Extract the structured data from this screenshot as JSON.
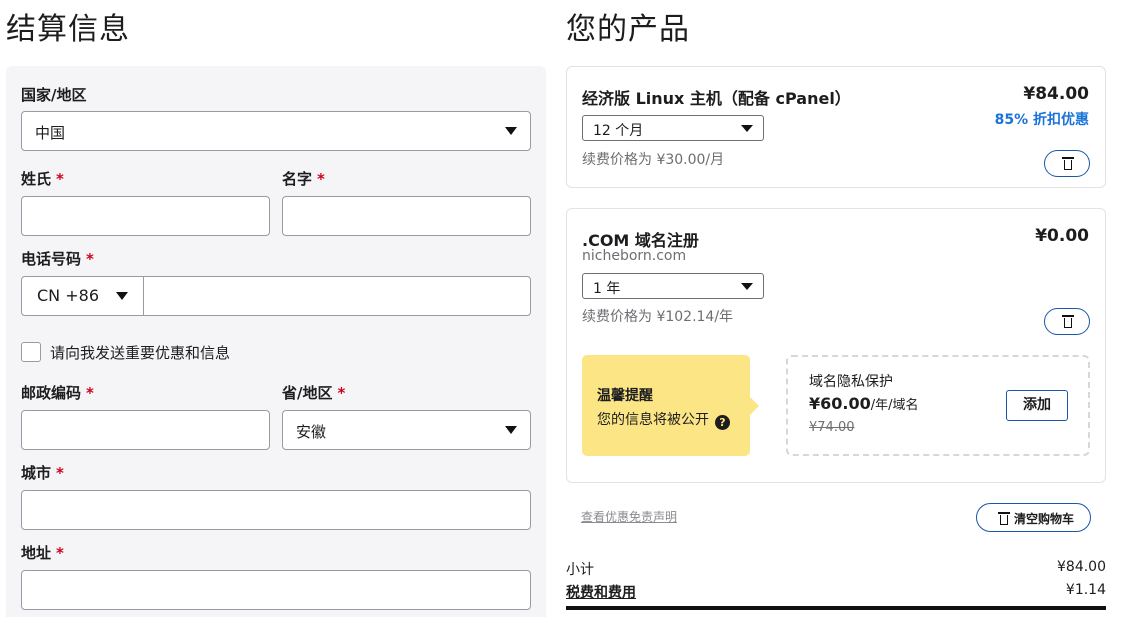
{
  "billing": {
    "title": "结算信息",
    "country_label": "国家/地区",
    "country_value": "中国",
    "last_name_label": "姓氏",
    "first_name_label": "名字",
    "phone_label": "电话号码",
    "phone_country_code": "CN +86",
    "phone_value": "",
    "offers_checkbox_label": "请向我发送重要优惠和信息",
    "offers_checked": false,
    "postal_label": "邮政编码",
    "province_label": "省/地区",
    "province_value": "安徽",
    "city_label": "城市",
    "address_label": "地址",
    "required_mark": "*"
  },
  "products": {
    "title": "您的产品",
    "items": [
      {
        "name": "经济版 Linux 主机（配备 cPanel）",
        "price": "¥84.00",
        "discount": "85% 折扣优惠",
        "term": "12 个月",
        "renewal": "续费价格为 ¥30.00/月"
      },
      {
        "name": ".COM 域名注册",
        "domain": "nicheborn.com",
        "price": "¥0.00",
        "term": "1 年",
        "renewal": "续费价格为 ¥102.14/年"
      }
    ],
    "tip": {
      "title": "温馨提醒",
      "text": "您的信息将被公开",
      "help": "?"
    },
    "privacy": {
      "title": "域名隐私保护",
      "price": "¥60.00",
      "unit": "/年/域名",
      "old_price": "¥74.00",
      "add_label": "添加"
    },
    "disclaimer": "查看优惠免责声明",
    "clear_cart_label": "清空购物车"
  },
  "summary": {
    "subtotal_label": "小计",
    "subtotal_value": "¥84.00",
    "tax_label": "税费和费用",
    "tax_value": "¥1.14"
  },
  "colors": {
    "accent_blue": "#1a73d9",
    "button_border": "#1a57a8",
    "required_red": "#d0021b",
    "tip_yellow": "#fbe584",
    "panel_bg": "#f5f5f7"
  }
}
